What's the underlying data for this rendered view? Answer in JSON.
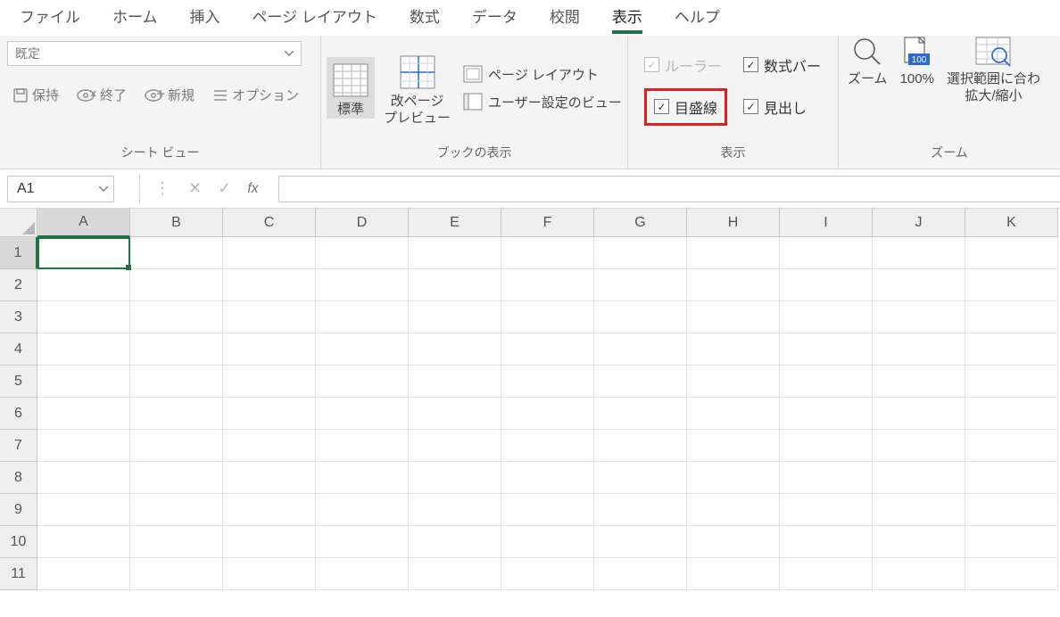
{
  "tabs": {
    "file": "ファイル",
    "home": "ホーム",
    "insert": "挿入",
    "pagelayout": "ページ レイアウト",
    "formulas": "数式",
    "data": "データ",
    "review": "校閲",
    "view": "表示",
    "help": "ヘルプ"
  },
  "active_tab": "view",
  "ribbon": {
    "sheetview": {
      "combo_text": "既定",
      "keep": "保持",
      "exit": "終了",
      "new": "新規",
      "options": "オプション",
      "group_label": "シート ビュー"
    },
    "workbook_views": {
      "normal": "標準",
      "page_break_l1": "改ページ",
      "page_break_l2": "プレビュー",
      "page_layout": "ページ レイアウト",
      "custom_views": "ユーザー設定のビュー",
      "group_label": "ブックの表示"
    },
    "show": {
      "ruler": "ルーラー",
      "formula_bar": "数式バー",
      "gridlines": "目盛線",
      "headings": "見出し",
      "group_label": "表示"
    },
    "zoom": {
      "zoom": "ズーム",
      "hundred": "100%",
      "selection_l1": "選択範囲に合わ",
      "selection_l2": "拡大/縮小",
      "group_label": "ズーム"
    }
  },
  "formula_bar": {
    "namebox": "A1",
    "fx": "fx",
    "formula_value": ""
  },
  "grid": {
    "columns": [
      "A",
      "B",
      "C",
      "D",
      "E",
      "F",
      "G",
      "H",
      "I",
      "J",
      "K"
    ],
    "rows": [
      "1",
      "2",
      "3",
      "4",
      "5",
      "6",
      "7",
      "8",
      "9",
      "10",
      "11"
    ],
    "active_cell": "A1"
  }
}
